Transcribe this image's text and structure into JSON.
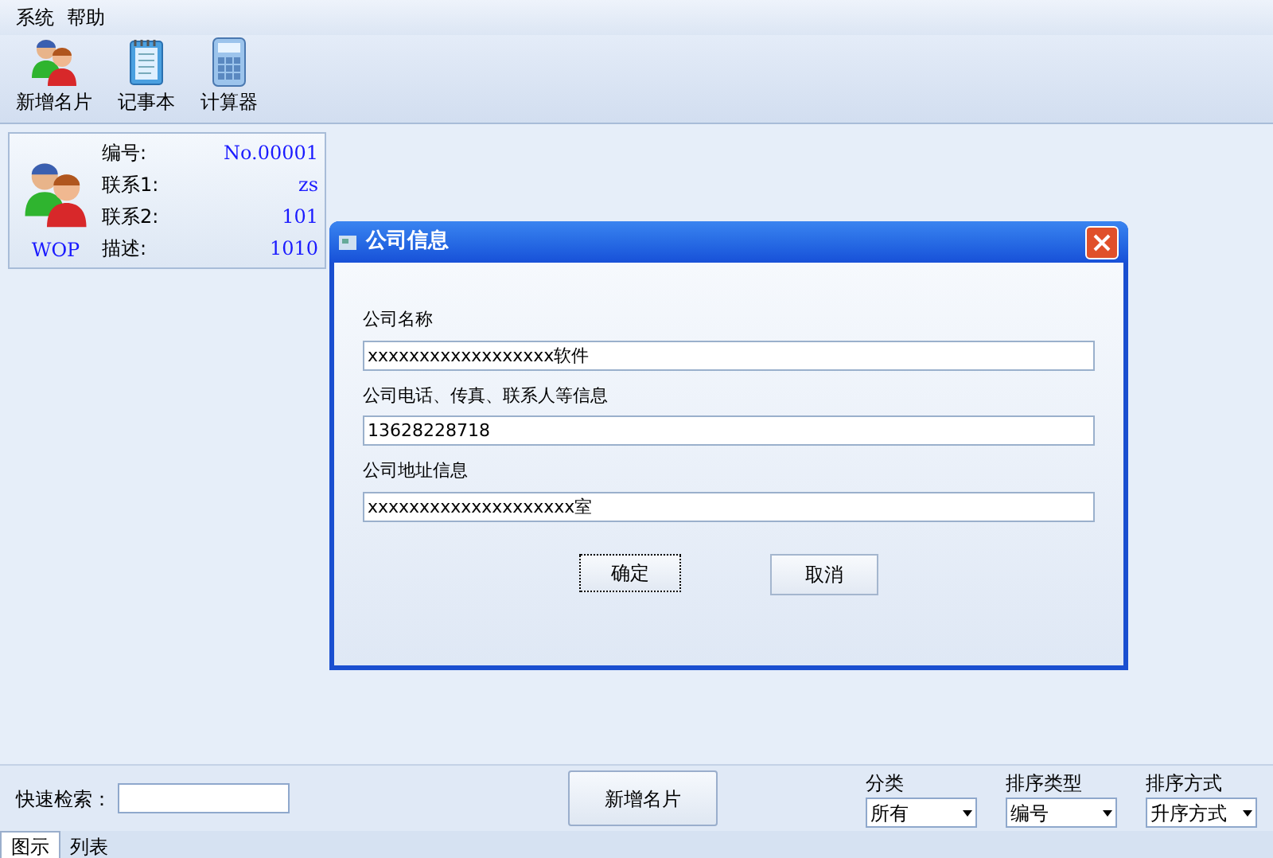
{
  "menu": [
    "系统",
    "帮助"
  ],
  "toolbar": [
    {
      "kind": "people",
      "label": "新增名片"
    },
    {
      "kind": "notepad",
      "label": "记事本"
    },
    {
      "kind": "calculator",
      "label": "计算器"
    }
  ],
  "card": {
    "caption": "WOP",
    "fields": [
      {
        "label": "编号:",
        "value": "No.00001"
      },
      {
        "label": "联系1:",
        "value": "zs"
      },
      {
        "label": "联系2:",
        "value": "101"
      },
      {
        "label": "描述:",
        "value": "1010"
      }
    ]
  },
  "dialog": {
    "title": "公司信息",
    "fields": [
      {
        "label": "公司名称",
        "value": "xxxxxxxxxxxxxxxxxx软件"
      },
      {
        "label": "公司电话、传真、联系人等信息",
        "value": "13628228718"
      },
      {
        "label": "公司地址信息",
        "value": "xxxxxxxxxxxxxxxxxxxx室"
      }
    ],
    "buttons": [
      {
        "label": "确定",
        "focused": true
      },
      {
        "label": "取消",
        "focused": false
      }
    ]
  },
  "bottom": {
    "search_label": "快速检索：",
    "add_button": "新增名片",
    "filters": [
      {
        "label": "分类",
        "value": "所有"
      },
      {
        "label": "排序类型",
        "value": "编号"
      },
      {
        "label": "排序方式",
        "value": "升序方式"
      }
    ]
  },
  "tabs": [
    {
      "label": "图示",
      "selected": true
    },
    {
      "label": "列表",
      "selected": false
    }
  ]
}
